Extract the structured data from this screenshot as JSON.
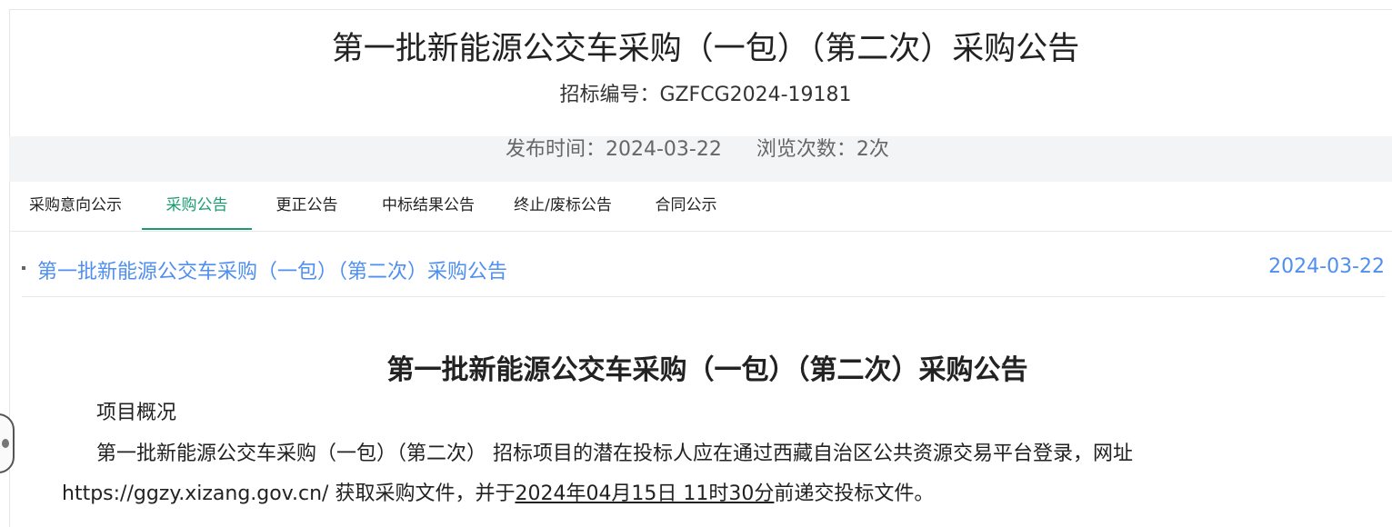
{
  "header": {
    "title": "第一批新能源公交车采购（一包）（第二次）采购公告",
    "bid_number": "招标编号：GZFCG2024-19181"
  },
  "meta": {
    "publish_time": "发布时间：2024-03-22",
    "view_count": "浏览次数：2次"
  },
  "tabs": [
    {
      "label": "采购意向公示",
      "active": false
    },
    {
      "label": "采购公告",
      "active": true
    },
    {
      "label": "更正公告",
      "active": false
    },
    {
      "label": "中标结果公告",
      "active": false
    },
    {
      "label": "终止/废标公告",
      "active": false
    },
    {
      "label": "合同公示",
      "active": false
    }
  ],
  "notice_list": {
    "items": [
      {
        "title": "第一批新能源公交车采购（一包）（第二次）采购公告",
        "date": "2024-03-22"
      }
    ]
  },
  "document": {
    "title": "第一批新能源公交车采购（一包）（第二次）采购公告",
    "section_heading": "项目概况",
    "paragraph_line1": "第一批新能源公交车采购（一包）（第二次） 招标项目的潜在投标人应在通过西藏自治区公共资源交易平台登录，网址",
    "paragraph_line2_before": "https://ggzy.xizang.gov.cn/ 获取采购文件，并于",
    "paragraph_line2_deadline": "2024年04月15日 11时30分",
    "paragraph_line2_after": "前递交投标文件。"
  },
  "colors": {
    "accent_green": "#1a9c73",
    "link_blue": "#4f8ff0",
    "meta_bar_bg": "#f3f4f6"
  }
}
